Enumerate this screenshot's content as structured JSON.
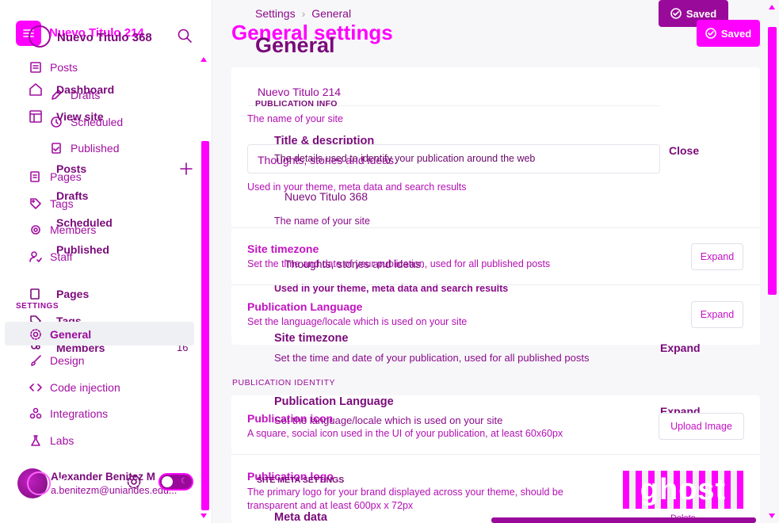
{
  "sidebar": {
    "site_title": "Nuevo Titulo 214",
    "site_title_overlay": "Nuevo Titulo 368",
    "nav": [
      {
        "label": "Posts",
        "icon": "posts-icon"
      },
      {
        "label": "Drafts",
        "icon": "pencil-icon"
      },
      {
        "label": "Scheduled",
        "icon": "clock-icon"
      },
      {
        "label": "Published",
        "icon": "published-icon"
      },
      {
        "label": "Pages",
        "icon": "pages-icon"
      },
      {
        "label": "Tags",
        "icon": "tag-icon"
      },
      {
        "label": "Members",
        "icon": "members-icon"
      },
      {
        "label": "Staff",
        "icon": "staff-icon"
      }
    ],
    "nav_overlay": [
      {
        "label": "Dashboard",
        "icon": "home-icon"
      },
      {
        "label": "View site",
        "icon": "layout-icon"
      },
      {
        "label": "Posts",
        "icon": "posts-icon"
      },
      {
        "label": "Drafts",
        "icon": ""
      },
      {
        "label": "Scheduled",
        "icon": ""
      },
      {
        "label": "Published",
        "icon": ""
      },
      {
        "label": "Pages",
        "icon": "pages-icon"
      },
      {
        "label": "Tags",
        "icon": "tag-icon"
      },
      {
        "label": "Members",
        "icon": "members-icon"
      }
    ],
    "members_count": "16",
    "settings_section": "SETTINGS",
    "settings_items": [
      {
        "label": "General",
        "icon": "gear-icon",
        "active": true
      },
      {
        "label": "Design",
        "icon": "brush-icon"
      },
      {
        "label": "Code injection",
        "icon": "code-icon"
      },
      {
        "label": "Integrations",
        "icon": "integrations-icon"
      },
      {
        "label": "Labs",
        "icon": "flask-icon"
      }
    ],
    "user": {
      "name": "Alexander Benitez M",
      "email": "a.benitezm@uniandes.edu..."
    }
  },
  "header": {
    "breadcrumb_parent": "Settings",
    "breadcrumb_sep": "›",
    "breadcrumb_current": "General",
    "page_title": "General settings",
    "page_title_overlay": "General",
    "saved_label": "Saved",
    "saved_label_2": "Saved"
  },
  "publication_info": {
    "section_label": "PUBLICATION INFO",
    "title_value": "Nuevo Titulo 214",
    "title_hint": "The name of your site",
    "title_desc_heading": "Title & description",
    "title_desc_sub": "The details used to identify your publication around the web",
    "close_label": "Close",
    "description_value": "Thoughts, stories and ideas.",
    "description_hint": "Used in your theme, meta data and search results",
    "title_value_2": "Nuevo Titulo 368",
    "title_hint_2": "The name of your site",
    "description_value_2": "Thoughts, stories and ideas.",
    "description_hint_2": "Used in your theme, meta data and search results",
    "timezone_title": "Site timezone",
    "timezone_desc": "Set the time and date of your publication, used for all published posts",
    "timezone_title_2": "Site timezone",
    "timezone_desc_2": "Set the time and date of your publication, used for all published posts",
    "timezone_expand": "Expand",
    "timezone_expand_2": "Expand",
    "language_title": "Publication Language",
    "language_desc": "Set the language/locale which is used on your site",
    "language_title_2": "Publication Language",
    "language_desc_2": "Set the language/locale which is used on your site",
    "language_expand": "Expand",
    "language_expand_2": "Expand"
  },
  "publication_identity": {
    "section_label": "PUBLICATION IDENTITY",
    "icon_title": "Publication icon",
    "icon_desc": "A square, social icon used in the UI of your publication, at least 60x60px",
    "upload_label": "Upload Image",
    "logo_title": "Publication logo",
    "logo_desc": "The primary logo for your brand displayed across your theme, should be transparent and at least 600px x 72px",
    "logo_image": "ghost",
    "delete_label": "Delete"
  },
  "meta": {
    "section_label": "SITE META SETTINGS",
    "meta_title": "Meta data"
  },
  "colors": {
    "accent": "#ff00ff",
    "dark_accent": "#9a0a9a",
    "saved_bg": "#9a0a9a"
  }
}
